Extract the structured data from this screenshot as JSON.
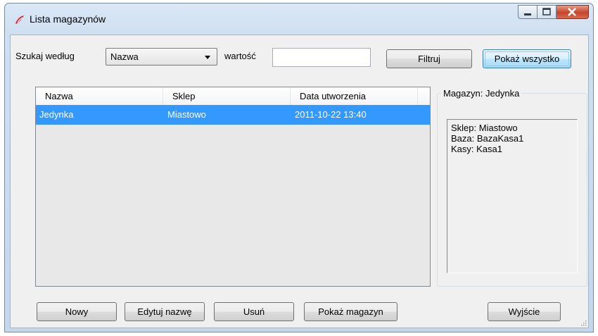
{
  "window": {
    "title": "Lista magazynów"
  },
  "search": {
    "label": "Szukaj według",
    "field_value": "Nazwa",
    "value_label": "wartość",
    "value_text": "",
    "filter_button": "Filtruj",
    "show_all_button": "Pokaż wszystko"
  },
  "table": {
    "columns": [
      "Nazwa",
      "Sklep",
      "Data utworzenia"
    ],
    "rows": [
      {
        "nazwa": "Jedynka",
        "sklep": "Miastowo",
        "data": "2011-10-22 13:40",
        "selected": true
      }
    ]
  },
  "details": {
    "group_title": "Magazyn: Jedynka",
    "lines": [
      "Sklep: Miastowo",
      "Baza: BazaKasa1",
      "Kasy: Kasa1"
    ]
  },
  "buttons": {
    "new": "Nowy",
    "edit_name": "Edytuj nazwę",
    "delete": "Usuń",
    "show_warehouse": "Pokaż magazyn",
    "exit": "Wyjście"
  },
  "colors": {
    "selection": "#3399ff",
    "app_icon": "#d7263d"
  }
}
